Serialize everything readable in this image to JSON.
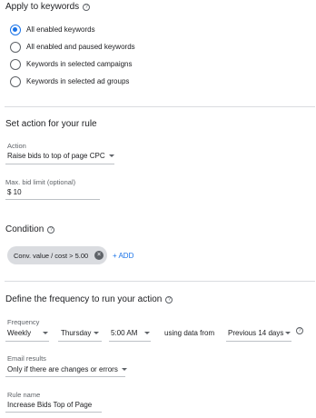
{
  "apply": {
    "title": "Apply to keywords",
    "options": [
      {
        "label": "All enabled keywords",
        "selected": true
      },
      {
        "label": "All enabled and paused keywords",
        "selected": false
      },
      {
        "label": "Keywords in selected campaigns",
        "selected": false
      },
      {
        "label": "Keywords in selected ad groups",
        "selected": false
      }
    ]
  },
  "action": {
    "title": "Set action for your rule",
    "action_label": "Action",
    "action_value": "Raise bids to top of page CPC",
    "max_bid_label": "Max. bid limit (optional)",
    "max_bid_value": "$ 10"
  },
  "condition": {
    "title": "Condition",
    "chip_text": "Conv. value / cost > 5.00",
    "add_label": "+ ADD"
  },
  "frequency": {
    "title": "Define the frequency to run your action",
    "label": "Frequency",
    "period": "Weekly",
    "day": "Thursday",
    "time": "5:00 AM",
    "using_text": "using data from",
    "range": "Previous 14 days"
  },
  "email": {
    "label": "Email results",
    "value": "Only if there are changes or errors"
  },
  "rule": {
    "label": "Rule name",
    "value": "Increase Bids Top of Page"
  },
  "colors": {
    "accent": "#1a73e8",
    "divider": "#dadce0",
    "chip_bg": "#dadce0"
  }
}
